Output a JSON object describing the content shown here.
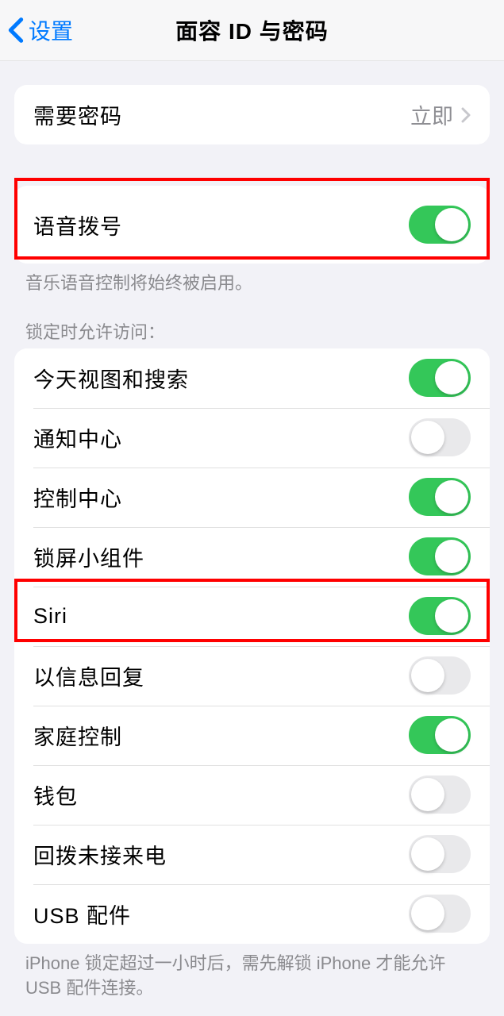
{
  "navbar": {
    "back_label": "设置",
    "title": "面容 ID 与密码"
  },
  "require_passcode": {
    "label": "需要密码",
    "value": "立即"
  },
  "voice_dial": {
    "label": "语音拨号",
    "enabled": true,
    "footer": "音乐语音控制将始终被启用。"
  },
  "allow_access": {
    "header": "锁定时允许访问：",
    "items": [
      {
        "label": "今天视图和搜索",
        "enabled": true
      },
      {
        "label": "通知中心",
        "enabled": false
      },
      {
        "label": "控制中心",
        "enabled": true
      },
      {
        "label": "锁屏小组件",
        "enabled": true
      },
      {
        "label": "Siri",
        "enabled": true
      },
      {
        "label": "以信息回复",
        "enabled": false
      },
      {
        "label": "家庭控制",
        "enabled": true
      },
      {
        "label": "钱包",
        "enabled": false
      },
      {
        "label": "回拨未接来电",
        "enabled": false
      },
      {
        "label": "USB 配件",
        "enabled": false
      }
    ],
    "footer": "iPhone 锁定超过一小时后，需先解锁 iPhone 才能允许 USB 配件连接。"
  }
}
